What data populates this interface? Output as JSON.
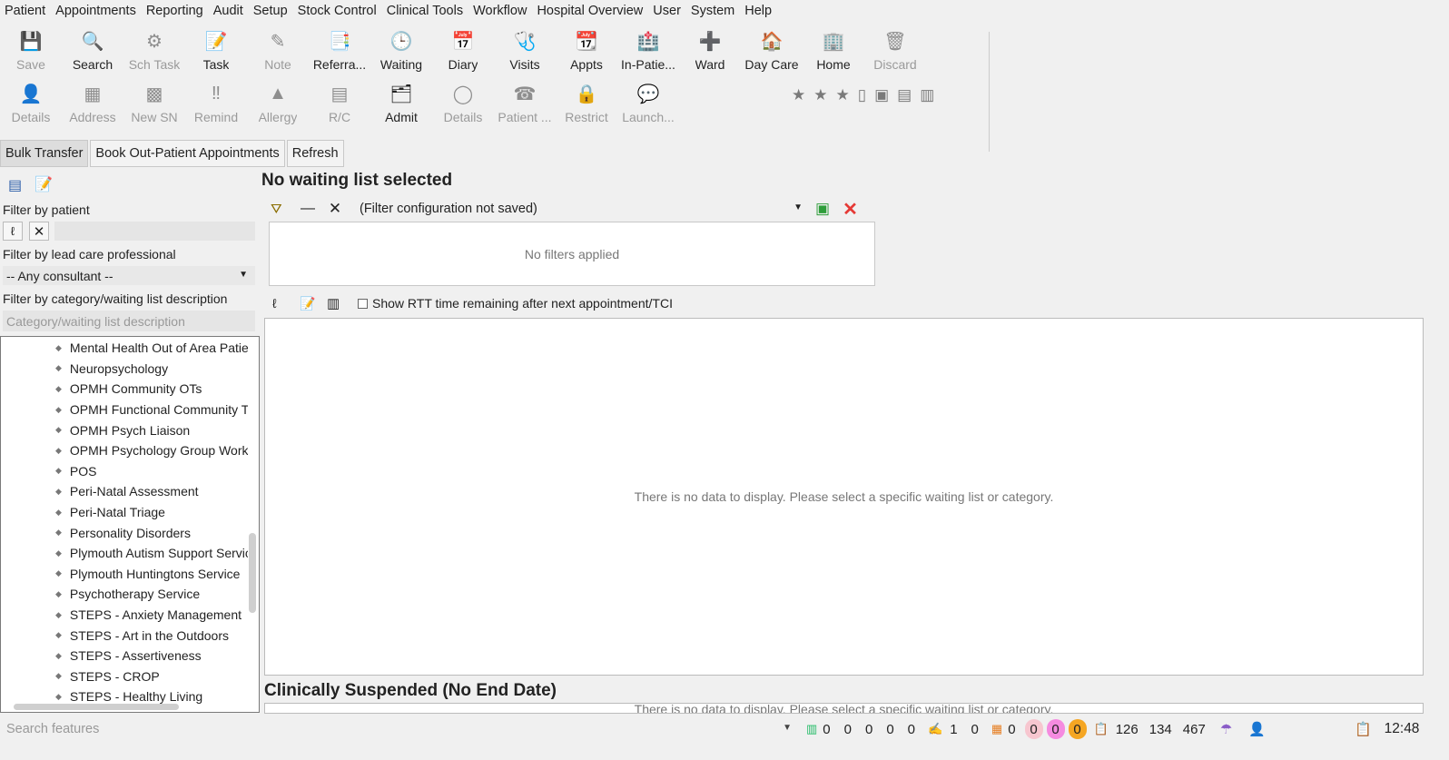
{
  "menu": [
    "Patient",
    "Appointments",
    "Reporting",
    "Audit",
    "Setup",
    "Stock Control",
    "Clinical Tools",
    "Workflow",
    "Hospital Overview",
    "User",
    "System",
    "Help"
  ],
  "toolbar1": [
    {
      "label": "Save",
      "icon": "save-icon",
      "glyph": "💾",
      "disabled": true
    },
    {
      "label": "Search",
      "icon": "search-icon",
      "glyph": "🔍",
      "disabled": false
    },
    {
      "label": "Sch Task",
      "icon": "scheduled-task-icon",
      "glyph": "⚙",
      "disabled": true
    },
    {
      "label": "Task",
      "icon": "task-icon",
      "glyph": "📝",
      "disabled": false
    },
    {
      "label": "Note",
      "icon": "note-icon",
      "glyph": "✎",
      "disabled": true
    },
    {
      "label": "Referra...",
      "icon": "referral-icon",
      "glyph": "📑",
      "disabled": false
    },
    {
      "label": "Waiting",
      "icon": "waiting-icon",
      "glyph": "🕒",
      "disabled": false
    },
    {
      "label": "Diary",
      "icon": "diary-icon",
      "glyph": "📅",
      "disabled": false
    },
    {
      "label": "Visits",
      "icon": "visits-icon",
      "glyph": "🩺",
      "disabled": false
    },
    {
      "label": "Appts",
      "icon": "appointments-icon",
      "glyph": "📆",
      "disabled": false
    },
    {
      "label": "In-Patie...",
      "icon": "in-patient-icon",
      "glyph": "🏥",
      "disabled": false
    },
    {
      "label": "Ward",
      "icon": "ward-icon",
      "glyph": "➕",
      "disabled": false
    },
    {
      "label": "Day Care",
      "icon": "day-care-icon",
      "glyph": "🏠",
      "disabled": false
    },
    {
      "label": "Home",
      "icon": "home-icon",
      "glyph": "🏢",
      "disabled": false
    },
    {
      "label": "Discard",
      "icon": "discard-icon",
      "glyph": "🗑",
      "disabled": true
    }
  ],
  "toolbar2": [
    {
      "label": "Details",
      "icon": "patient-details-icon",
      "glyph": "👤",
      "disabled": true
    },
    {
      "label": "Address",
      "icon": "address-icon",
      "glyph": "▦",
      "disabled": true
    },
    {
      "label": "New SN",
      "icon": "new-sn-icon",
      "glyph": "▩",
      "disabled": true
    },
    {
      "label": "Remind",
      "icon": "remind-icon",
      "glyph": "‼",
      "disabled": true
    },
    {
      "label": "Allergy",
      "icon": "allergy-icon",
      "glyph": "▲",
      "disabled": true
    },
    {
      "label": "R/C",
      "icon": "rc-icon",
      "glyph": "▤",
      "disabled": true
    },
    {
      "label": "Admit",
      "icon": "admit-icon",
      "glyph": "🗂",
      "disabled": false
    },
    {
      "label": "Details",
      "icon": "details-circle-icon",
      "glyph": "◯",
      "disabled": true
    },
    {
      "label": "Patient ...",
      "icon": "patient-phone-icon",
      "glyph": "☎",
      "disabled": true
    },
    {
      "label": "Restrict",
      "icon": "restrict-lock-icon",
      "glyph": "🔒",
      "disabled": true
    },
    {
      "label": "Launch...",
      "icon": "launch-chat-icon",
      "glyph": "💬",
      "disabled": true
    }
  ],
  "actions": [
    "Bulk Transfer",
    "Book Out-Patient Appointments",
    "Refresh"
  ],
  "left": {
    "filter_patient": "Filter by patient",
    "filter_lead": "Filter by lead care professional",
    "consultant": "-- Any consultant --",
    "filter_category": "Filter by category/waiting list description",
    "category_placeholder": "Category/waiting list description",
    "tree": [
      "Mental Health Out of Area Patie",
      "Neuropsychology",
      "OPMH Community OTs",
      "OPMH Functional Community Te",
      "OPMH Psych Liaison",
      "OPMH Psychology Group Work",
      "POS",
      "Peri-Natal Assessment",
      "Peri-Natal Triage",
      "Personality Disorders",
      "Plymouth Autism Support Servic",
      "Plymouth Huntingtons Service",
      "Psychotherapy Service",
      "STEPS - Anxiety Management",
      "STEPS - Art in the Outdoors",
      "STEPS - Assertiveness",
      "STEPS - CROP",
      "STEPS - Healthy Living"
    ]
  },
  "main": {
    "title": "No waiting list selected",
    "filter_config": "(Filter configuration not saved)",
    "no_filters": "No filters applied",
    "rtt_label": "Show RTT time remaining after next appointment/TCI",
    "empty_msg": "There is no data to display. Please select a specific waiting list or category.",
    "suspended_title": "Clinically Suspended (No End Date)",
    "empty_msg2": "There is no data to display. Please select a specific waiting list or category."
  },
  "status": {
    "search_placeholder": "Search features",
    "counts_a": [
      "0",
      "0",
      "0",
      "0",
      "0"
    ],
    "count_b1": "1",
    "count_b2": "0",
    "count_c": "0",
    "pill1": "0",
    "pill2": "0",
    "pill3": "0",
    "n1": "126",
    "n2": "134",
    "n3": "467",
    "time": "12:48"
  },
  "colors": {
    "pill1": "#f7c6cf",
    "pill2": "#f58be0",
    "pill3": "#f5a623",
    "save_green": "#2e9d3a",
    "close_red": "#e53935"
  }
}
